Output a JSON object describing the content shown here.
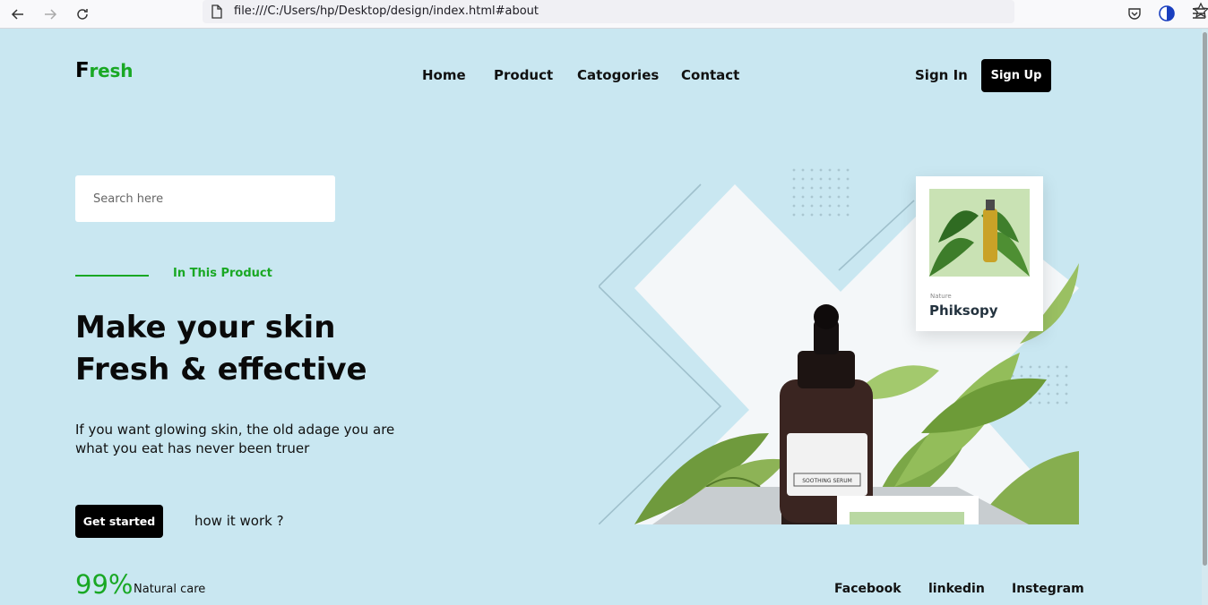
{
  "browser": {
    "url": "file:///C:/Users/hp/Desktop/design/index.html#about"
  },
  "header": {
    "logo_first": "F",
    "logo_rest": "resh",
    "nav": [
      "Home",
      "Product",
      "Catogories",
      "Contact"
    ],
    "sign_in": "Sign In",
    "sign_up": "Sign Up"
  },
  "hero": {
    "search_placeholder": "Search here",
    "tag": "In This Product",
    "headline_line1": "Make your skin",
    "headline_line2": "Fresh & effective",
    "description": "If you want glowing skin, the old adage you are what you eat has never been truer",
    "cta_primary": "Get started",
    "cta_secondary": "how it work ?",
    "stat_value": "99%",
    "stat_label": "Natural care"
  },
  "product_card": {
    "label": "Nature",
    "title": "Phiksopy"
  },
  "bottle_label": "SOOTHING SERUM",
  "social": [
    "Facebook",
    "linkedin",
    "Instegram"
  ],
  "colors": {
    "page_bg": "#c9e7f1",
    "accent_green": "#19a824",
    "button_black": "#000000"
  }
}
